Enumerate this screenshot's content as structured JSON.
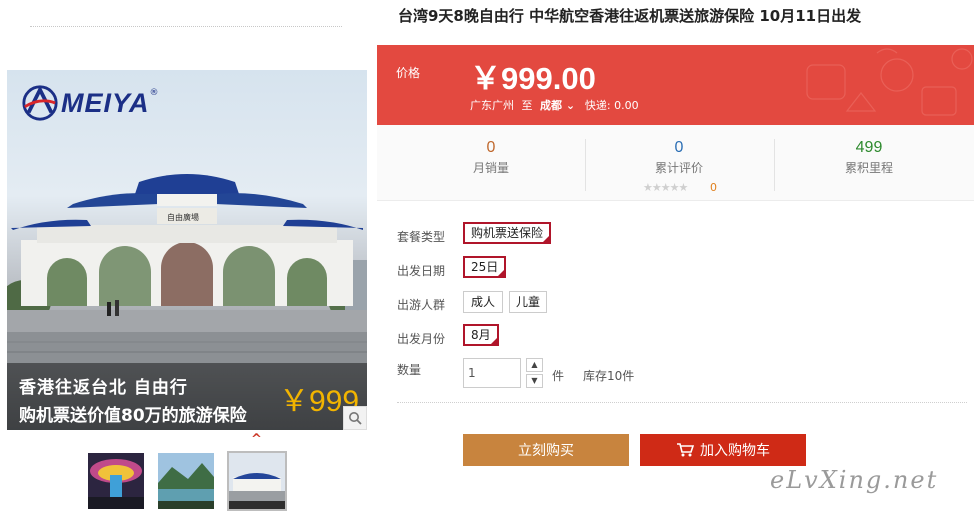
{
  "product": {
    "title": "台湾9天8晚自由行 中华航空香港往返机票送旅游保险 10月11日出发"
  },
  "gallery": {
    "brand": "MEIYA",
    "brand_mark": "®",
    "caption_line1": "香港往返台北  自由行",
    "caption_line2": "购机票送价值80万的旅游保险",
    "caption_price": "￥999",
    "zoom_icon": "magnifier-icon",
    "thumb_arrow": "^"
  },
  "price_panel": {
    "label": "价格",
    "price": "￥999.00",
    "origin": "广东广州",
    "to_word": "至",
    "destination": "成都",
    "shipping_label": "快递:",
    "shipping_fee": "0.00"
  },
  "stats": {
    "monthly_sales": {
      "value": "0",
      "label": "月销量",
      "color": "#c0692e"
    },
    "reviews": {
      "value": "0",
      "label": "累计评价",
      "color": "#2c6fb5",
      "stars": "★★★★★",
      "stars_count": "0"
    },
    "points": {
      "value": "499",
      "label": "累积里程",
      "color": "#2e8a2e"
    }
  },
  "options": {
    "package": {
      "label": "套餐类型",
      "values": [
        "购机票送保险"
      ],
      "selected": "购机票送保险"
    },
    "date": {
      "label": "出发日期",
      "values": [
        "25日"
      ],
      "selected": "25日"
    },
    "travelers": {
      "label": "出游人群",
      "values": [
        "成人",
        "儿童"
      ]
    },
    "month": {
      "label": "出发月份",
      "values": [
        "8月"
      ],
      "selected": "8月"
    }
  },
  "quantity": {
    "label": "数量",
    "value": "1",
    "up": "▲",
    "down": "▼",
    "unit": "件",
    "stock": "库存10件"
  },
  "actions": {
    "buy_now": "立刻购买",
    "add_to_cart": "加入购物车",
    "cart_icon": "cart-icon"
  },
  "watermark": "eLvXing.net",
  "colors": {
    "price_bg": "#e34940",
    "buy_bg": "#c8843e",
    "cart_bg": "#cf2a16",
    "selected_border": "#b0152a"
  }
}
